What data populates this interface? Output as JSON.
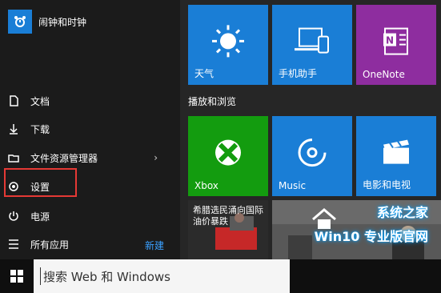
{
  "left_panel": {
    "top_app": {
      "label": "闹钟和时钟",
      "icon": "alarm-clock-icon"
    },
    "menu": [
      {
        "label": "文档",
        "icon": "document-icon"
      },
      {
        "label": "下载",
        "icon": "download-icon"
      },
      {
        "label": "文件资源管理器",
        "icon": "folder-icon",
        "has_chevron": true
      },
      {
        "label": "设置",
        "icon": "gear-icon",
        "highlighted": true
      },
      {
        "label": "电源",
        "icon": "power-icon"
      },
      {
        "label": "所有应用",
        "icon": "list-icon"
      }
    ],
    "new_label": "新建"
  },
  "tiles_top": [
    {
      "label": "天气",
      "icon": "sun-icon",
      "color": "#1a7ed6"
    },
    {
      "label": "手机助手",
      "icon": "phone-laptop-icon",
      "color": "#1a7ed6"
    },
    {
      "label": "OneNote",
      "icon": "onenote-icon",
      "color": "#8e2d9f"
    }
  ],
  "section": {
    "title": "播放和浏览"
  },
  "tiles_middle": [
    {
      "label": "Xbox",
      "icon": "xbox-icon",
      "color": "#139c0f"
    },
    {
      "label": "Music",
      "icon": "music-disc-icon",
      "color": "#1a7ed6"
    },
    {
      "label": "电影和电视",
      "icon": "clapperboard-icon",
      "color": "#1a7ed6"
    }
  ],
  "news_tile": {
    "headline": "希腊选民涌向国际油价暴跌"
  },
  "taskbar": {
    "search_placeholder": "搜索 Web 和 Windows"
  },
  "watermark": {
    "line1": "Win10 专业版官网",
    "line2": "系统之家"
  }
}
